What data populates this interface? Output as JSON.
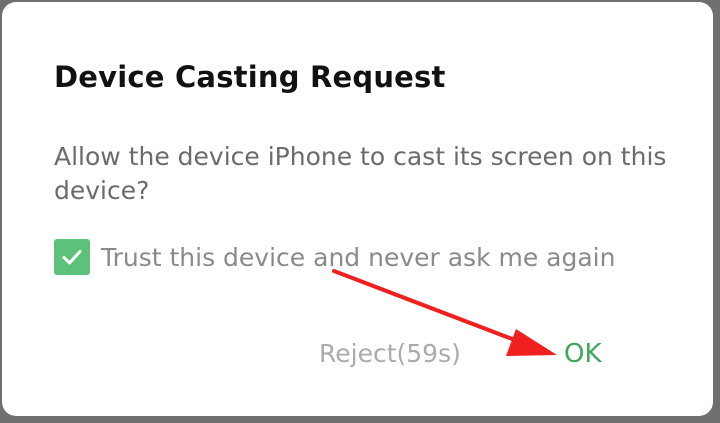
{
  "dialog": {
    "title": "Device Casting Request",
    "message": "Allow the device iPhone to cast its screen on this device?",
    "trust_checkbox": {
      "label": "Trust this device and never ask me again",
      "checked": true,
      "color": "#5cc17a"
    },
    "reject_label": "Reject(59s)",
    "ok_label": "OK",
    "accent_color": "#3ea85a"
  },
  "annotation": {
    "arrow_icon": "red-arrow-icon",
    "color": "#f02020"
  }
}
